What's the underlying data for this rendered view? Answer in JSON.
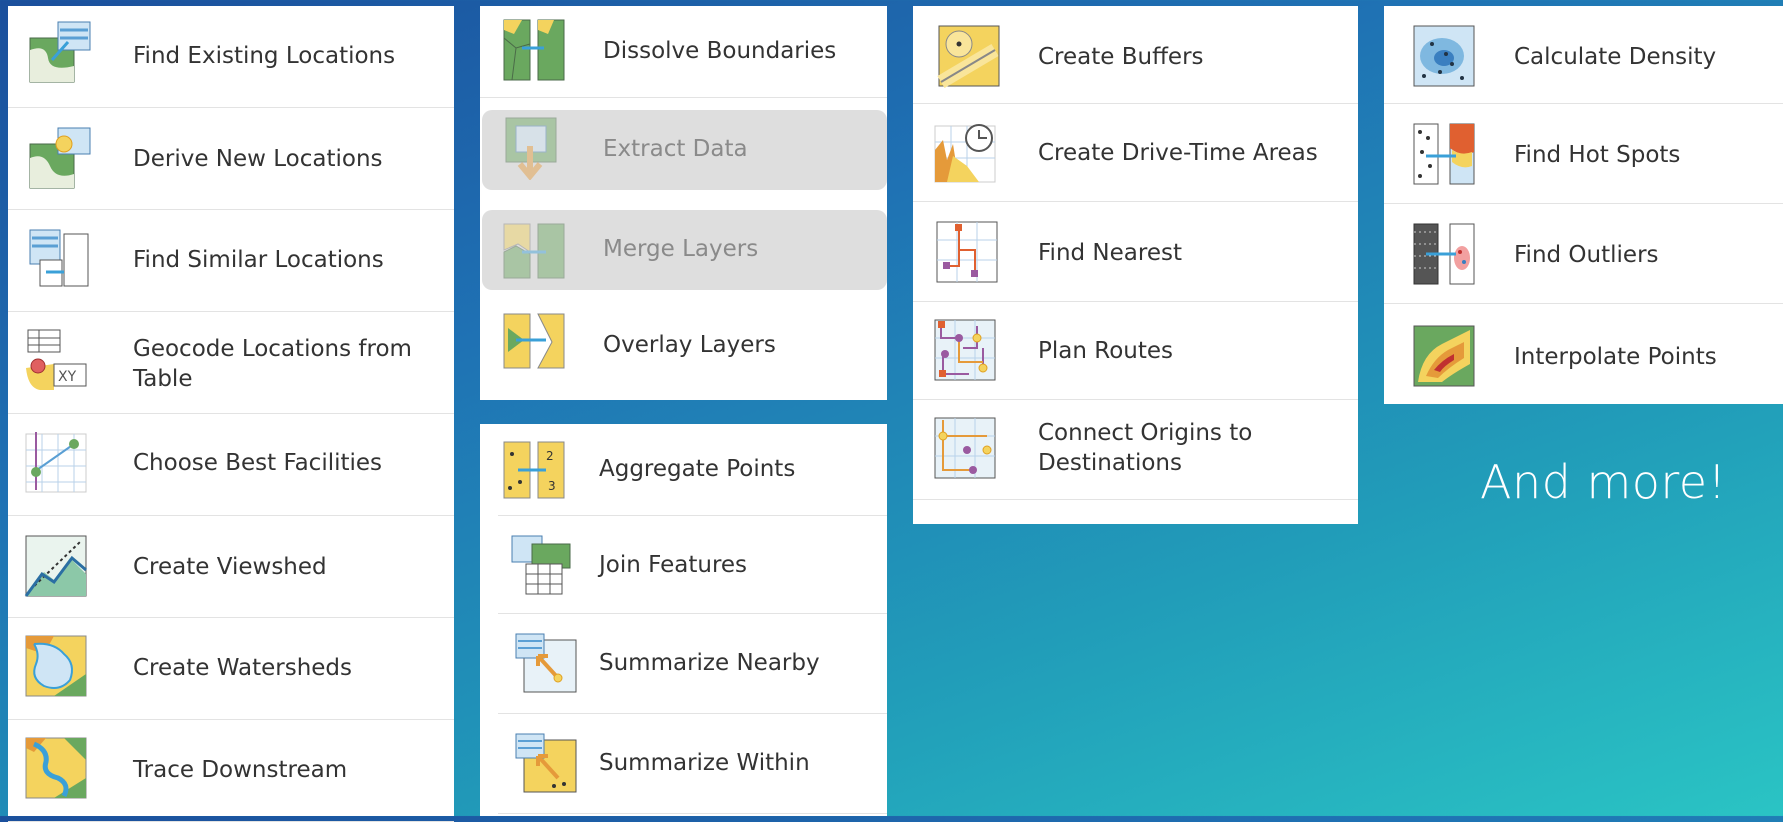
{
  "columns": [
    {
      "items": [
        {
          "label": "Find Existing Locations",
          "icon": "find-existing-locations-icon"
        },
        {
          "label": "Derive New Locations",
          "icon": "derive-new-locations-icon"
        },
        {
          "label": "Find Similar Locations",
          "icon": "find-similar-locations-icon"
        },
        {
          "label": "Geocode Locations from Table",
          "icon": "geocode-table-icon"
        },
        {
          "label": "Choose Best Facilities",
          "icon": "choose-best-facilities-icon"
        },
        {
          "label": "Create Viewshed",
          "icon": "viewshed-icon"
        },
        {
          "label": "Create Watersheds",
          "icon": "watersheds-icon"
        },
        {
          "label": "Trace Downstream",
          "icon": "trace-downstream-icon"
        }
      ]
    },
    {
      "items": [
        {
          "label": "Dissolve Boundaries",
          "icon": "dissolve-boundaries-icon"
        },
        {
          "label": "Extract Data",
          "icon": "extract-data-icon",
          "disabled": true
        },
        {
          "label": "Merge Layers",
          "icon": "merge-layers-icon",
          "disabled": true
        },
        {
          "label": "Overlay Layers",
          "icon": "overlay-layers-icon"
        }
      ]
    },
    {
      "items": [
        {
          "label": "Aggregate Points",
          "icon": "aggregate-points-icon"
        },
        {
          "label": "Join Features",
          "icon": "join-features-icon"
        },
        {
          "label": "Summarize Nearby",
          "icon": "summarize-nearby-icon"
        },
        {
          "label": "Summarize Within",
          "icon": "summarize-within-icon"
        }
      ]
    },
    {
      "items": [
        {
          "label": "Create Buffers",
          "icon": "buffers-icon"
        },
        {
          "label": "Create Drive-Time Areas",
          "icon": "drive-time-icon"
        },
        {
          "label": "Find Nearest",
          "icon": "find-nearest-icon"
        },
        {
          "label": "Plan Routes",
          "icon": "plan-routes-icon"
        },
        {
          "label": "Connect Origins to Destinations",
          "icon": "connect-origins-icon"
        }
      ]
    },
    {
      "items": [
        {
          "label": "Calculate Density",
          "icon": "density-icon"
        },
        {
          "label": "Find Hot Spots",
          "icon": "hot-spots-icon"
        },
        {
          "label": "Find Outliers",
          "icon": "outliers-icon"
        },
        {
          "label": "Interpolate Points",
          "icon": "interpolate-icon"
        }
      ]
    }
  ],
  "more_text": "And more!",
  "colors": {
    "disabled_bg": "#dedede",
    "label": "#333333",
    "disabled_label": "#8a8a8a"
  }
}
